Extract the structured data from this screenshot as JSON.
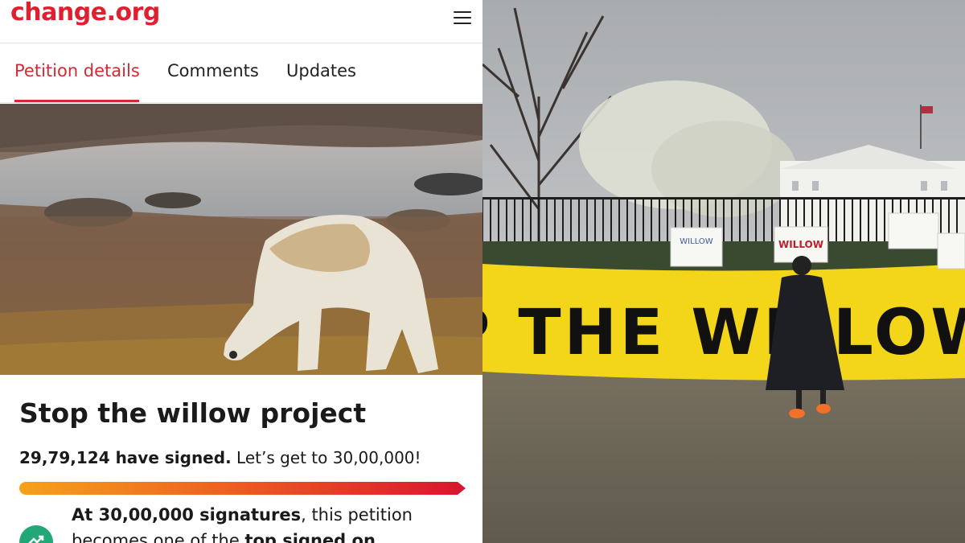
{
  "app": {
    "logo_text": "change.org",
    "menu_icon": "hamburger-menu-icon",
    "brand_color": "#e0202f"
  },
  "tabs": [
    {
      "label": "Petition details",
      "active": true
    },
    {
      "label": "Comments",
      "active": false
    },
    {
      "label": "Updates",
      "active": false
    }
  ],
  "petition": {
    "title": "Stop the willow project",
    "signed_count": "29,79,124 have signed.",
    "goal_text": "Let’s get to 30,00,000!",
    "progress_fraction": 0.993,
    "milestone_icon": "trending-up-icon",
    "milestone_bold": "At 30,00,000 signatures",
    "milestone_text": ", this petition becomes one of the ",
    "milestone_bold2": "top signed on"
  },
  "banner": {
    "text": "STOP THE WILLOW OIL"
  },
  "signs": [
    "WILLOW",
    "WILLOW"
  ]
}
